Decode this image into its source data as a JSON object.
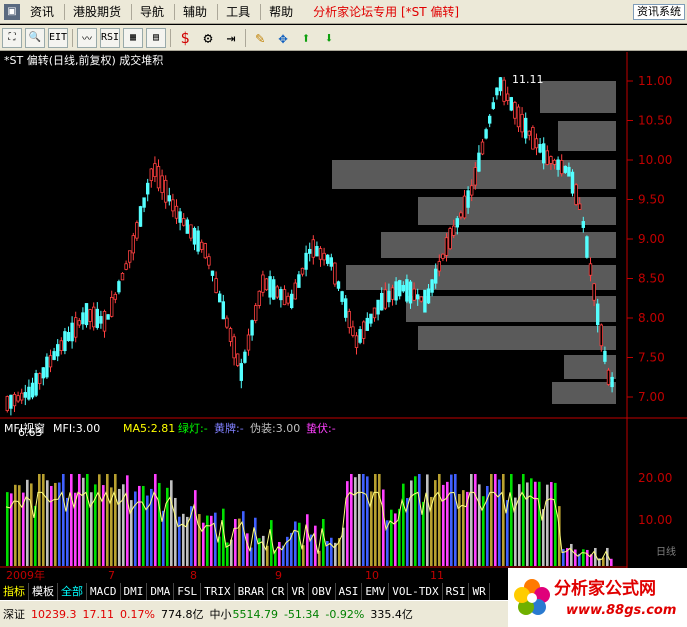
{
  "menu": {
    "items": [
      "资讯",
      "港股期货",
      "导航",
      "辅助",
      "工具",
      "帮助"
    ],
    "forum_text": "分析家论坛专用",
    "stock_tag": "[*ST 偏转]",
    "right_button": "资讯系统"
  },
  "toolbar": {
    "icons": [
      "chart-mode-icon",
      "zoom-icon",
      "eit-icon",
      "line-icon",
      "rsi-icon",
      "table-icon",
      "grid-icon",
      "dollar-icon",
      "link-icon",
      "import-icon",
      "pencil-icon",
      "cross-move-icon",
      "arrow-up-icon",
      "arrow-down-icon"
    ],
    "labels": [
      "⛶",
      "🔍",
      "EIT",
      "〰",
      "RSI",
      "▦",
      "▤",
      "$",
      "⚙",
      "⇥",
      "✎",
      "✥",
      "⬆",
      "⬇"
    ]
  },
  "chart_title": "*ST 偏转(日线,前复权) 成交堆积",
  "price_axis": {
    "ticks": [
      "11.00",
      "10.50",
      "10.00",
      "9.50",
      "9.00",
      "8.50",
      "8.00",
      "7.50",
      "7.00"
    ],
    "high_label": "11.11",
    "low_label": "6.63"
  },
  "indicator": {
    "name": "MFI视窗",
    "mfi": "MFI:3.00",
    "ma5": "MA5:2.81",
    "green": "绿灯:-",
    "yellow": "黄牌:-",
    "fake": "伪装:3.00",
    "lurk": "蛰伏:-",
    "ticks": [
      "20.00",
      "10.00"
    ]
  },
  "x_axis": {
    "labels": [
      "2009年",
      "7",
      "8",
      "9",
      "10",
      "11"
    ]
  },
  "side_label": "日线",
  "tabs": [
    "指标",
    "模板",
    "全部",
    "MACD",
    "DMI",
    "DMA",
    "FSL",
    "TRIX",
    "BRAR",
    "CR",
    "VR",
    "OBV",
    "ASI",
    "EMV",
    "VOL-TDX",
    "RSI",
    "WR"
  ],
  "status": {
    "sz_name": "深证",
    "sz_index": "10239.3",
    "sz_change": "17.11",
    "sz_pct": "0.17%",
    "sz_amount": "774.8亿",
    "zx_name": "中小",
    "zx_index": "5514.79",
    "zx_change": "-51.34",
    "zx_pct": "-0.92%",
    "zx_amount": "335.4亿"
  },
  "logo": {
    "title": "分析家公式网",
    "url": "www.88gs.com"
  },
  "colors": {
    "up": "#ff4040",
    "down": "#54ffff",
    "axis": "#c00000",
    "stack": "#5a5a5a"
  }
}
